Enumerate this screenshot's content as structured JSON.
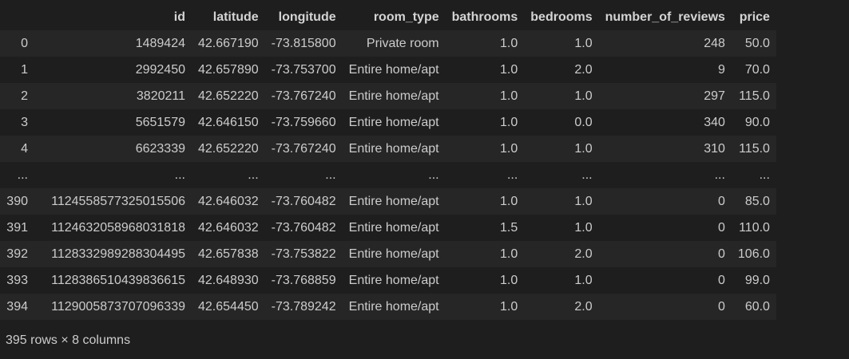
{
  "table": {
    "columns": [
      "",
      "id",
      "latitude",
      "longitude",
      "room_type",
      "bathrooms",
      "bedrooms",
      "number_of_reviews",
      "price"
    ],
    "rows": [
      [
        "0",
        "1489424",
        "42.667190",
        "-73.815800",
        "Private room",
        "1.0",
        "1.0",
        "248",
        "50.0"
      ],
      [
        "1",
        "2992450",
        "42.657890",
        "-73.753700",
        "Entire home/apt",
        "1.0",
        "2.0",
        "9",
        "70.0"
      ],
      [
        "2",
        "3820211",
        "42.652220",
        "-73.767240",
        "Entire home/apt",
        "1.0",
        "1.0",
        "297",
        "115.0"
      ],
      [
        "3",
        "5651579",
        "42.646150",
        "-73.759660",
        "Entire home/apt",
        "1.0",
        "0.0",
        "340",
        "90.0"
      ],
      [
        "4",
        "6623339",
        "42.652220",
        "-73.767240",
        "Entire home/apt",
        "1.0",
        "1.0",
        "310",
        "115.0"
      ],
      [
        "...",
        "...",
        "...",
        "...",
        "...",
        "...",
        "...",
        "...",
        "..."
      ],
      [
        "390",
        "1124558577325015506",
        "42.646032",
        "-73.760482",
        "Entire home/apt",
        "1.0",
        "1.0",
        "0",
        "85.0"
      ],
      [
        "391",
        "1124632058968031818",
        "42.646032",
        "-73.760482",
        "Entire home/apt",
        "1.5",
        "1.0",
        "0",
        "110.0"
      ],
      [
        "392",
        "1128332989288304495",
        "42.657838",
        "-73.753822",
        "Entire home/apt",
        "1.0",
        "2.0",
        "0",
        "106.0"
      ],
      [
        "393",
        "1128386510439836615",
        "42.648930",
        "-73.768859",
        "Entire home/apt",
        "1.0",
        "1.0",
        "0",
        "99.0"
      ],
      [
        "394",
        "1129005873707096339",
        "42.654450",
        "-73.789242",
        "Entire home/apt",
        "1.0",
        "2.0",
        "0",
        "60.0"
      ]
    ]
  },
  "footer": {
    "shape_text": "395 rows × 8 columns"
  },
  "colors": {
    "background": "#1e1e1e",
    "row_alt": "#262626",
    "text": "#cccccc"
  }
}
